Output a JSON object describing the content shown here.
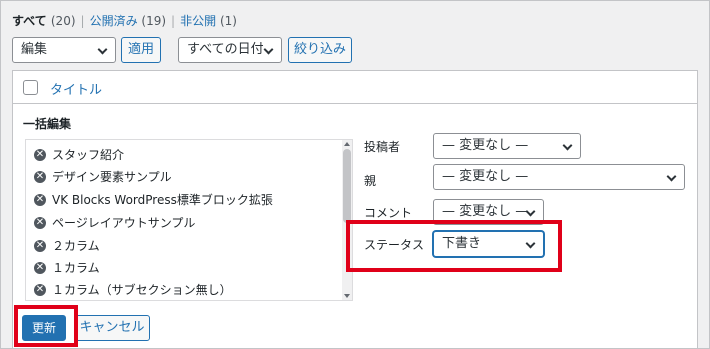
{
  "status_filter": {
    "all_label": "すべて",
    "all_count": "(20)",
    "published_label": "公開済み",
    "published_count": "(19)",
    "private_label": "非公開",
    "private_count": "(1)",
    "separator": "|"
  },
  "tablenav": {
    "bulk_action_value": "編集",
    "apply_label": "適用",
    "date_filter_value": "すべての日付",
    "filter_label": "絞り込み"
  },
  "table": {
    "column_title": "タイトル"
  },
  "bulk_edit": {
    "legend": "一括編集",
    "remove_glyph": "✕",
    "items": [
      {
        "label": "スタッフ紹介"
      },
      {
        "label": "デザイン要素サンプル"
      },
      {
        "label": "VK Blocks WordPress標準ブロック拡張"
      },
      {
        "label": "ページレイアウトサンプル"
      },
      {
        "label": "２カラム"
      },
      {
        "label": "１カラム"
      },
      {
        "label": "１カラム（サブセクション無し）"
      }
    ],
    "author_label": "投稿者",
    "author_value": "— 変更なし —",
    "parent_label": "親",
    "parent_value": "— 変更なし —",
    "comments_label": "コメント",
    "comments_value": "— 変更なし —",
    "status_label": "ステータス",
    "status_value": "下書き",
    "update_label": "更新",
    "cancel_label": "キャンセル"
  },
  "colors": {
    "accent": "#2271b1",
    "highlight": "#e00019",
    "background": "#f0f0f1"
  }
}
